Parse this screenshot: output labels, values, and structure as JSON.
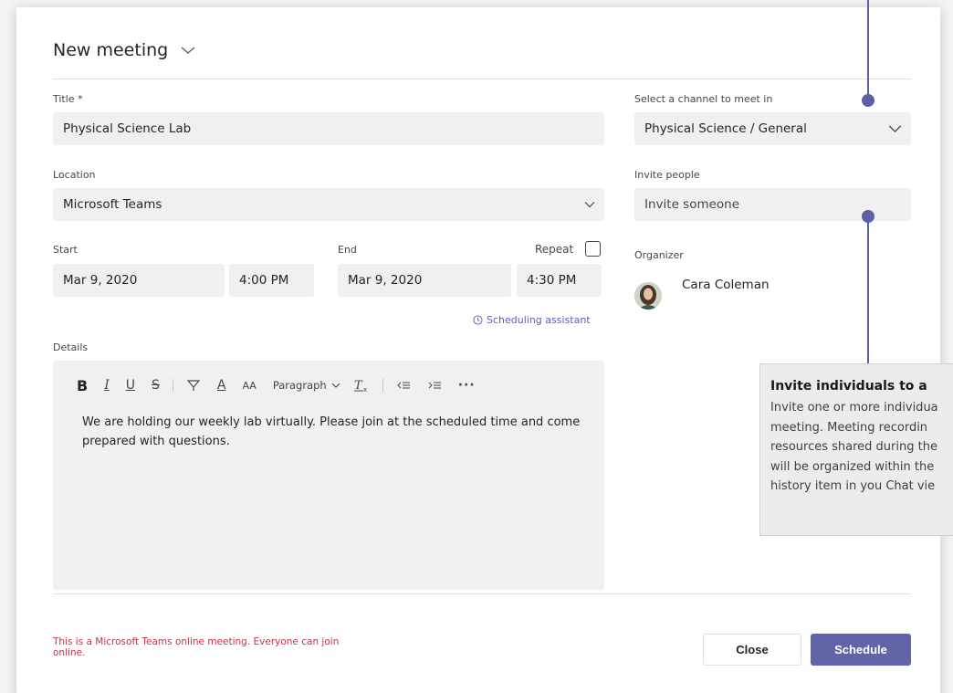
{
  "dialog": {
    "title": "New meeting",
    "title_field": {
      "label": "Title *",
      "value": "Physical Science Lab"
    },
    "location": {
      "label": "Location",
      "value": "Microsoft Teams"
    },
    "start": {
      "label": "Start",
      "date": "Mar 9, 2020",
      "time": "4:00 PM"
    },
    "end": {
      "label": "End",
      "date": "Mar 9, 2020",
      "time": "4:30 PM"
    },
    "repeat": {
      "label": "Repeat",
      "checked": false
    },
    "scheduling_assistant": "Scheduling assistant",
    "details": {
      "label": "Details",
      "toolbar": {
        "bold": "B",
        "italic": "I",
        "underline": "U",
        "strikethrough": "S",
        "font_color": "A",
        "font_size": "AA",
        "paragraph": "Paragraph",
        "more": "···"
      },
      "body": "We are holding our weekly lab virtually.  Please join at the scheduled time and come prepared with questions."
    },
    "channel": {
      "label": "Select a channel to meet in",
      "value": "Physical Science / General"
    },
    "invite": {
      "label": "Invite people",
      "placeholder": "Invite someone"
    },
    "organizer": {
      "label": "Organizer",
      "name": "Cara Coleman"
    },
    "notice": "This is a Microsoft Teams online meeting. Everyone can join online.",
    "buttons": {
      "close": "Close",
      "schedule": "Schedule"
    }
  },
  "callout": {
    "title": "Invite individuals to a",
    "lines": [
      "Invite one or more individua",
      "meeting.  Meeting recordin",
      "resources shared during the",
      "will be organized within the",
      "history item in you Chat vie"
    ]
  },
  "colors": {
    "accent": "#6264a7",
    "callout": "#5b5fa8",
    "notice": "#c4314b",
    "field_bg": "#f0f0f0"
  }
}
